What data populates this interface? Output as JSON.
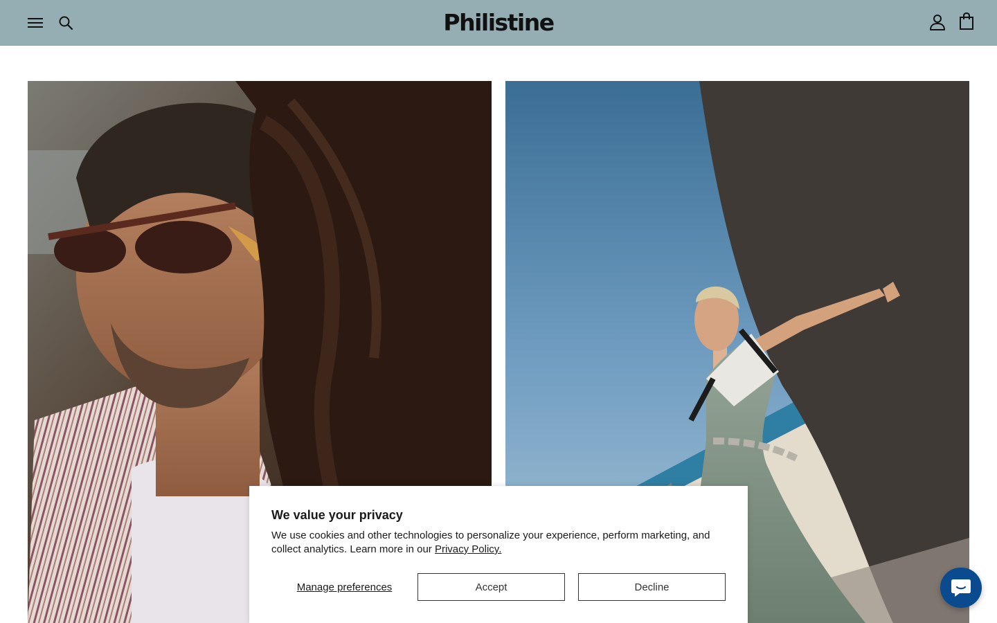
{
  "header": {
    "logo": "Philistine",
    "menu_icon": "hamburger-menu-icon",
    "search_icon": "search-icon",
    "account_icon": "user-account-icon",
    "cart_icon": "shopping-bag-icon",
    "background": "#95aeb3"
  },
  "hero": {
    "left_image": "man-with-sunglasses-photo",
    "right_image": "woman-in-dress-beach-photo"
  },
  "cookie_banner": {
    "title": "We value your privacy",
    "body": "We use cookies and other technologies to personalize your experience, perform marketing, and collect analytics. Learn more in our",
    "policy_link": "Privacy Policy.",
    "manage_label": "Manage preferences",
    "accept_label": "Accept",
    "decline_label": "Decline"
  },
  "chat": {
    "icon": "chat-bubble-icon",
    "color": "#0a4a8f"
  }
}
